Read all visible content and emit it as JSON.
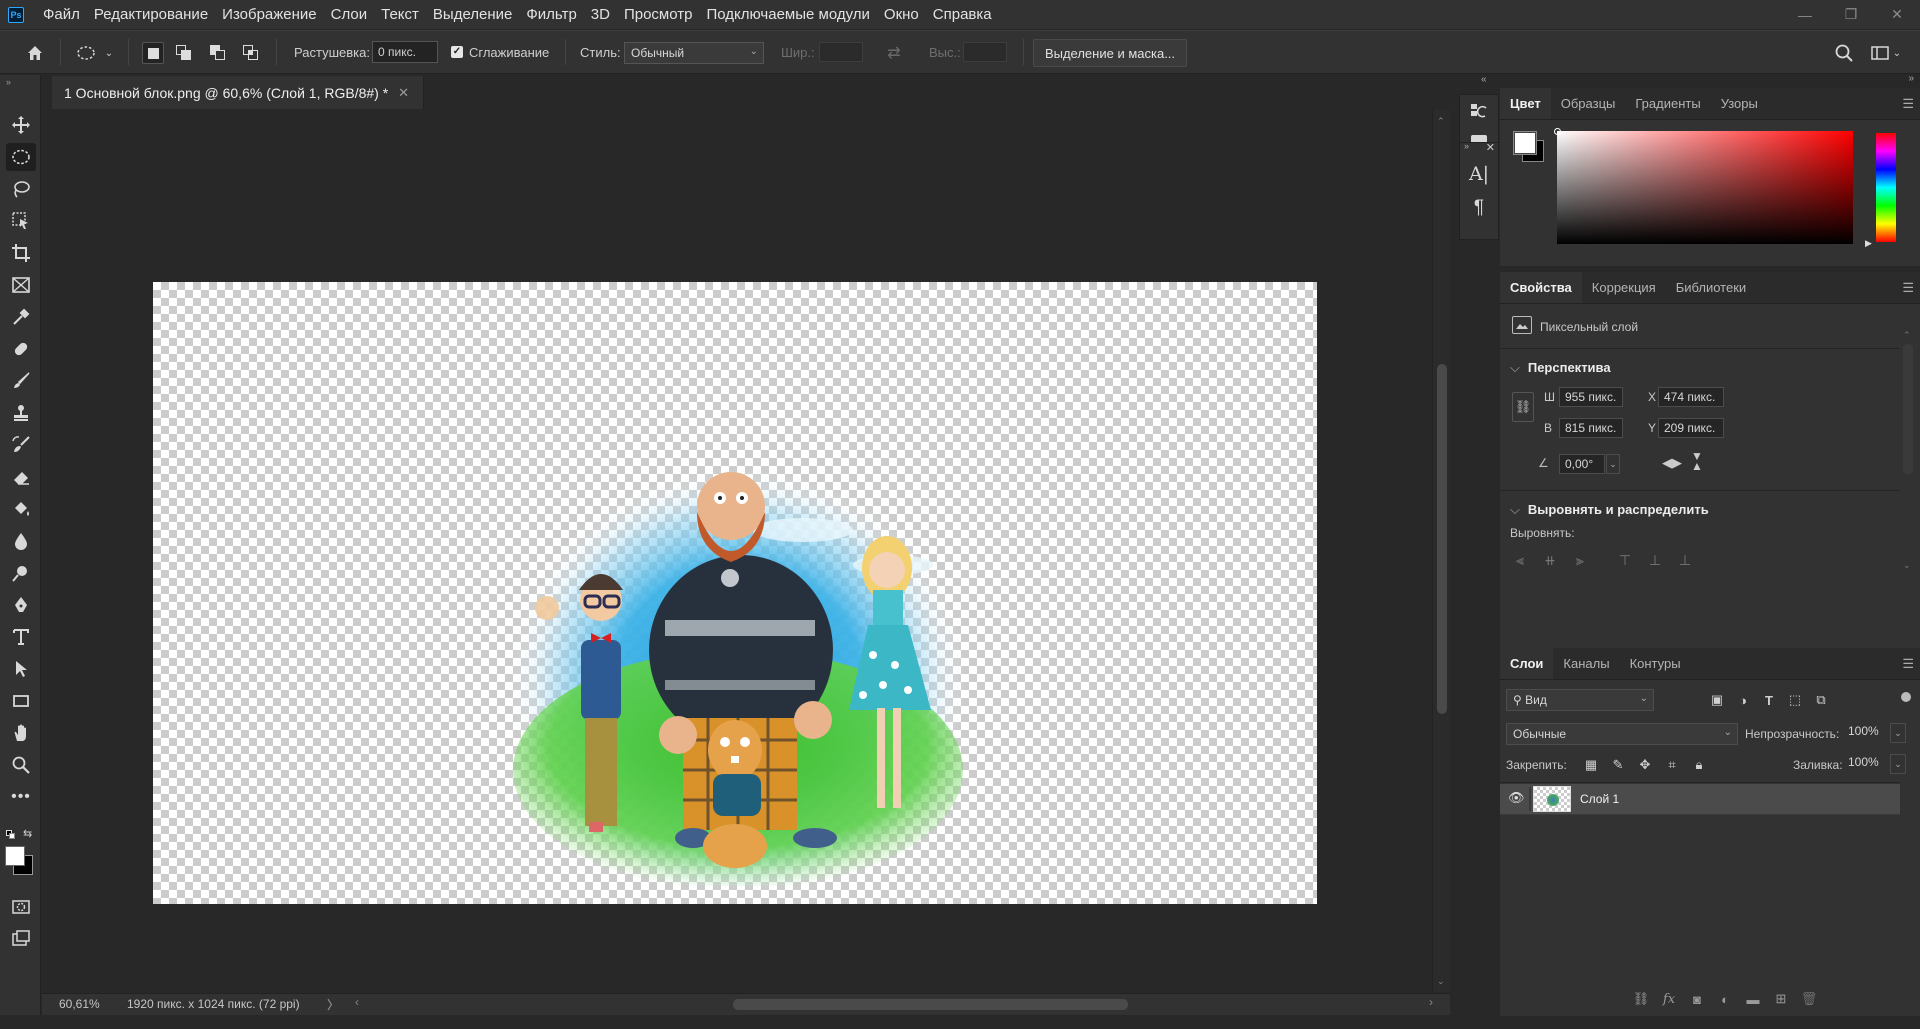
{
  "app": {
    "logo_text": "Ps"
  },
  "menu": [
    "Файл",
    "Редактирование",
    "Изображение",
    "Слои",
    "Текст",
    "Выделение",
    "Фильтр",
    "3D",
    "Просмотр",
    "Подключаемые модули",
    "Окно",
    "Справка"
  ],
  "window_controls": {
    "minimize": "—",
    "restore": "❐",
    "close": "✕"
  },
  "options": {
    "feather_label": "Растушевка:",
    "feather_value": "0 пикс.",
    "antialias_label": "Сглаживание",
    "antialias_checked": true,
    "style_label": "Стиль:",
    "style_value": "Обычный",
    "width_label": "Шир.:",
    "height_label": "Выс.:",
    "select_mask_button": "Выделение и маска..."
  },
  "document": {
    "tab_title": "1 Основной блок.png @ 60,6% (Слой 1, RGB/8#) *",
    "close": "✕"
  },
  "status": {
    "zoom": "60,61%",
    "info": "1920 пикс. x 1024 пикс. (72 ppi)",
    "arrow": "〉",
    "left_arrow": "‹",
    "right_arrow": "›"
  },
  "color_panel": {
    "tabs": [
      "Цвет",
      "Образцы",
      "Градиенты",
      "Узоры"
    ],
    "active_tab": 0
  },
  "properties_panel": {
    "tabs": [
      "Свойства",
      "Коррекция",
      "Библиотеки"
    ],
    "active_tab": 0,
    "layer_kind": "Пиксельный слой",
    "transform_header": "Перспектива",
    "w_label": "Ш",
    "w_value": "955 пикс.",
    "h_label": "В",
    "h_value": "815 пикс.",
    "x_label": "X",
    "x_value": "474 пикс.",
    "y_label": "Y",
    "y_value": "209 пикс.",
    "angle_value": "0,00°",
    "align_header": "Выровнять и распределить",
    "align_label": "Выровнять:"
  },
  "layers_panel": {
    "tabs": [
      "Слои",
      "Каналы",
      "Контуры"
    ],
    "active_tab": 0,
    "filter_label": "Вид",
    "blend_mode": "Обычные",
    "opacity_label": "Непрозрачность:",
    "opacity_value": "100%",
    "lock_label": "Закрепить:",
    "fill_label": "Заливка:",
    "fill_value": "100%",
    "layers": [
      {
        "name": "Слой 1",
        "visible": true,
        "selected": true
      }
    ]
  },
  "colors": {
    "foreground": "#ffffff",
    "background": "#000000",
    "accent": "#31a8ff"
  }
}
